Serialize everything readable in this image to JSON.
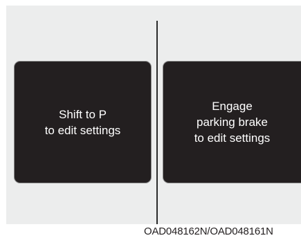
{
  "left_screen": {
    "lines": [
      "Shift to P",
      "to edit settings"
    ]
  },
  "right_screen": {
    "lines": [
      "Engage",
      "parking brake",
      "to edit settings"
    ]
  },
  "caption": "OAD048162N/OAD048161N",
  "colors": {
    "panel_background": "#eceded",
    "screen_background": "#231f20",
    "screen_text": "#ffffff",
    "divider": "#2a2a2a"
  }
}
